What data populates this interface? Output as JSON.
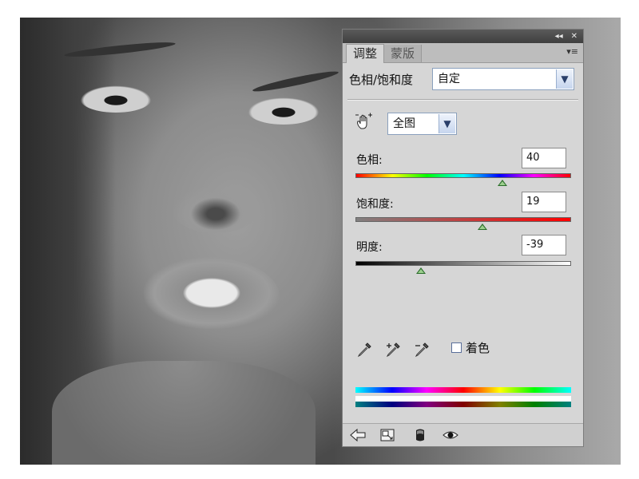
{
  "panel": {
    "tabs": [
      {
        "label": "调整",
        "active": true
      },
      {
        "label": "蒙版",
        "active": false
      }
    ],
    "titlebar_icons": [
      "collapse-icon",
      "close-icon"
    ],
    "preset": {
      "label": "色相/饱和度",
      "value": "自定"
    },
    "channel": {
      "value": "全图"
    },
    "hue": {
      "label": "色相:",
      "value": "40",
      "fraction": 0.68
    },
    "saturation": {
      "label": "饱和度:",
      "value": "19",
      "fraction": 0.59
    },
    "lightness": {
      "label": "明度:",
      "value": "-39",
      "fraction": 0.305
    },
    "colorize": {
      "label": "着色",
      "checked": false
    },
    "eyedroppers": [
      "eyedropper-icon",
      "eyedropper-plus-icon",
      "eyedropper-minus-icon"
    ],
    "bottom_icons": [
      "back-arrow-icon",
      "expand-view-icon",
      "clip-layer-icon",
      "visibility-eye-icon"
    ]
  },
  "colors": {
    "panel_bg": "#d6d6d6",
    "titlebar": "#4a4a4a",
    "select_border": "#8aa0bd",
    "thumb": "#2a6d2a"
  }
}
